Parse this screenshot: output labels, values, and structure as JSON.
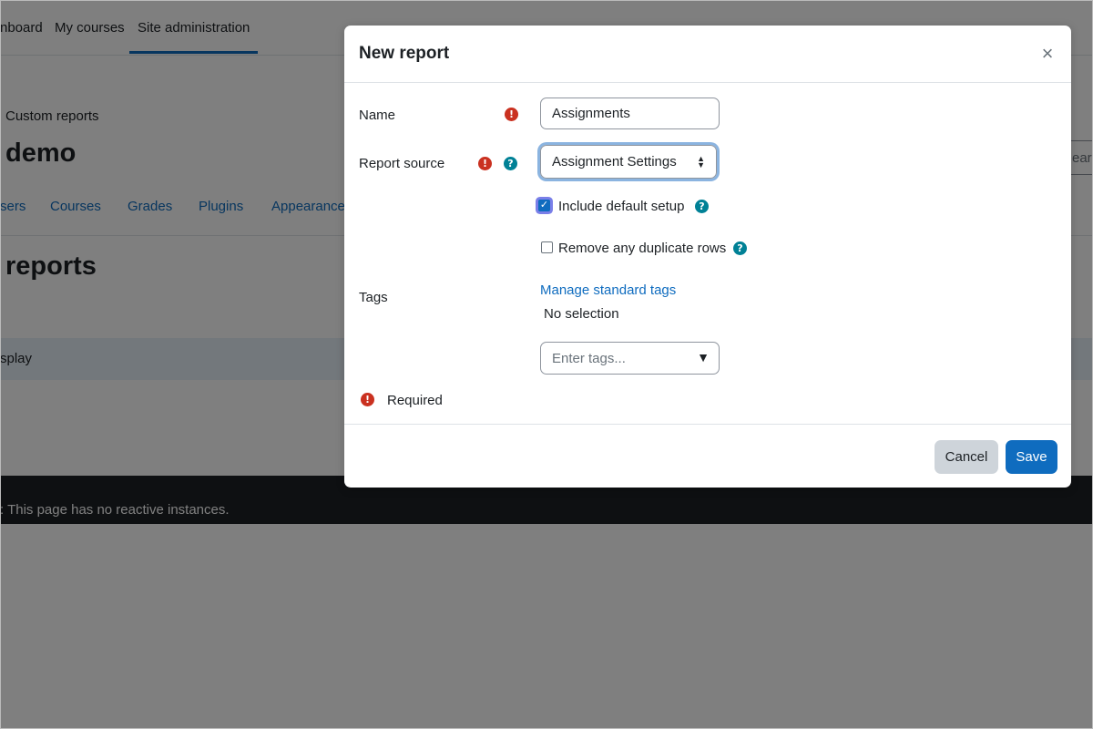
{
  "background": {
    "nav": [
      "nboard",
      "My courses",
      "Site administration"
    ],
    "breadcrumb": "Custom reports",
    "heading": "demo",
    "search_partial": "earc",
    "secondary_nav": [
      "sers",
      "Courses",
      "Grades",
      "Plugins",
      "Appearance"
    ],
    "section_heading": "reports",
    "info_text": "splay",
    "footer_text": ": This page has no reactive instances."
  },
  "modal": {
    "title": "New report",
    "close_glyph": "×",
    "fields": {
      "name_label": "Name",
      "name_value": "Assignments",
      "source_label": "Report source",
      "source_value": "Assignment Settings",
      "include_default_label": "Include default setup",
      "include_default_checked": true,
      "remove_duplicates_label": "Remove any duplicate rows",
      "remove_duplicates_checked": false,
      "tags_label": "Tags",
      "manage_tags_link": "Manage standard tags",
      "tags_selection": "No selection",
      "tags_placeholder": "Enter tags..."
    },
    "required_note": "Required",
    "buttons": {
      "cancel": "Cancel",
      "save": "Save"
    }
  },
  "icons": {
    "required": "exclamation-circle-icon",
    "help": "question-circle-icon"
  },
  "colors": {
    "primary": "#0f6cbf",
    "required": "#ca3120",
    "help": "#008196",
    "footer_bg": "#1d2125"
  }
}
